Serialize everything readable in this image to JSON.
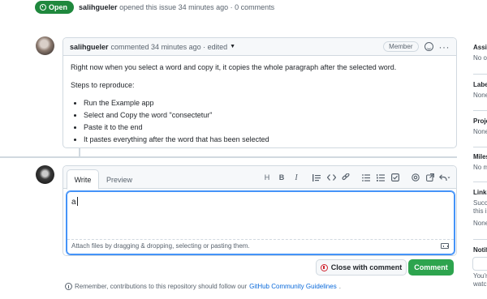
{
  "issue_header": {
    "status": "Open",
    "author": "salihgueler",
    "summary": "opened this issue 34 minutes ago · 0 comments"
  },
  "comment": {
    "author": "salihgueler",
    "meta": "commented 34 minutes ago · edited",
    "role_badge": "Member",
    "paragraph": "Right now when you select a word and copy it, it copies the whole paragraph after the selected word.",
    "steps_heading": "Steps to reproduce:",
    "steps": [
      "Run the Example app",
      "Select and Copy the word \"consectetur\"",
      "Paste it to the end",
      "It pastes everything after the word that has been selected"
    ]
  },
  "editor": {
    "tabs": [
      "Write",
      "Preview"
    ],
    "toolbar_icons": [
      "heading-icon",
      "bold-icon",
      "italic-icon",
      "quote-icon",
      "code-icon",
      "link-icon",
      "unordered-list-icon",
      "ordered-list-icon",
      "tasklist-icon",
      "mention-icon",
      "reference-icon",
      "reply-icon"
    ],
    "toolbar_glyphs": {
      "heading": "H",
      "bold": "B",
      "italic": "I"
    },
    "text_value": "a",
    "attach_hint": "Attach files by dragging & dropping, selecting or pasting them."
  },
  "actions": {
    "close_label": "Close with comment",
    "comment_label": "Comment"
  },
  "guidelines": {
    "prefix": "Remember, contributions to this repository should follow our",
    "link": "GitHub Community Guidelines",
    "suffix": "."
  },
  "sidebar": {
    "sections": [
      {
        "title": "Assig",
        "sub": "No on"
      },
      {
        "title": "Label",
        "sub": "None"
      },
      {
        "title": "Proje",
        "sub": "None"
      },
      {
        "title": "Miles",
        "sub": "No m"
      },
      {
        "title": "Linke",
        "sub": "Succe",
        "sub2": "this is",
        "sub3": "None"
      },
      {
        "title": "Notifi",
        "sub": "You'r",
        "sub2": "watch"
      }
    ]
  },
  "colors": {
    "open_green": "#1f883d",
    "comment_green": "#2da44e",
    "link_blue": "#0969da",
    "focus_blue": "#4493f8",
    "close_red": "#d1242f"
  }
}
